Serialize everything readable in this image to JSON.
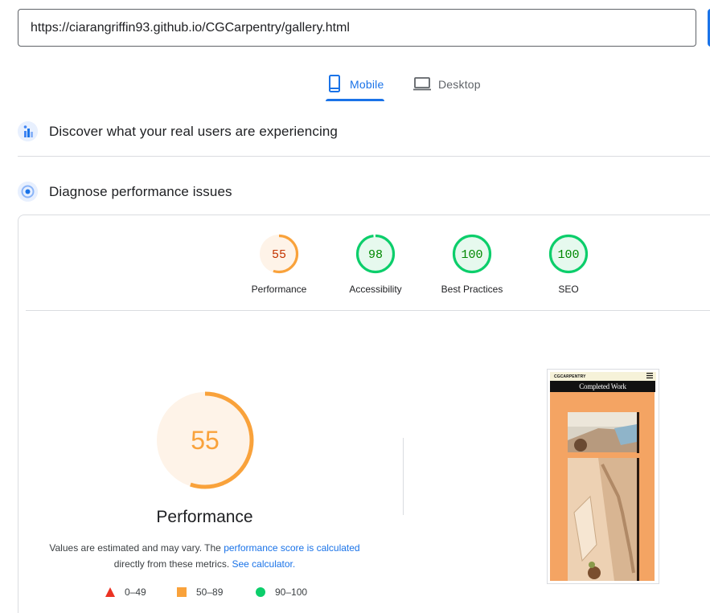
{
  "url_input": {
    "value": "https://ciarangriffin93.github.io/CGCarpentry/gallery.html"
  },
  "tabs": [
    {
      "label": "Mobile",
      "icon": "smartphone-icon",
      "selected": true
    },
    {
      "label": "Desktop",
      "icon": "laptop-icon",
      "selected": false
    }
  ],
  "sections": {
    "real_users": {
      "title": "Discover what your real users are experiencing",
      "icon": "crux-users-icon"
    },
    "diagnose": {
      "title": "Diagnose performance issues",
      "icon": "lighthouse-icon"
    }
  },
  "categories": [
    {
      "label": "Performance",
      "score": "55",
      "value": 0.55,
      "status": "average"
    },
    {
      "label": "Accessibility",
      "score": "98",
      "value": 0.98,
      "status": "pass"
    },
    {
      "label": "Best Practices",
      "score": "100",
      "value": 1.0,
      "status": "pass"
    },
    {
      "label": "SEO",
      "score": "100",
      "value": 1.0,
      "status": "pass"
    }
  ],
  "performance_detail": {
    "score": "55",
    "value": 0.55,
    "title": "Performance",
    "note_prefix": "Values are estimated and may vary. The",
    "note_link1": "performance score is calculated",
    "note_middle": "directly from these metrics.",
    "note_link2": "See calculator."
  },
  "legend": [
    {
      "range": "0–49",
      "shape": "triangle",
      "color": "#eb3223"
    },
    {
      "range": "50–89",
      "shape": "square",
      "color": "#f9a23b"
    },
    {
      "range": "90–100",
      "shape": "circle",
      "color": "#0cce6b"
    }
  ],
  "page_screenshot": {
    "site_logo": "CGCARPENTRY",
    "heading": "Completed Work"
  },
  "colors": {
    "accent": "#1a73e8",
    "average": "#f9a23b",
    "average_text": "#c33300",
    "average_fill": "#fef3e8",
    "pass": "#0cce6b",
    "pass_text": "#008800",
    "pass_fill": "#e6f9ee"
  }
}
